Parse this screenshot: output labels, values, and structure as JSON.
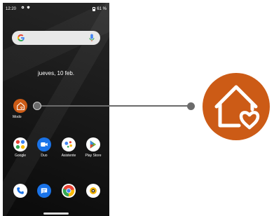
{
  "status": {
    "time": "12:20",
    "battery": "61 %"
  },
  "date": "jueves, 10 feb.",
  "apps": {
    "modo": "Modo",
    "google": "Google",
    "duo": "Duo",
    "asistente": "Asistente",
    "playstore": "Play Store"
  },
  "icons": {
    "search": "google-g-icon",
    "mic": "mic-icon",
    "modo": "home-heart-icon"
  },
  "colors": {
    "accent": "#cc5b16",
    "duo": "#1a73e8",
    "phone": "#1a73e8",
    "messages": "#1a73e8",
    "connector": "#6b6b6b"
  }
}
